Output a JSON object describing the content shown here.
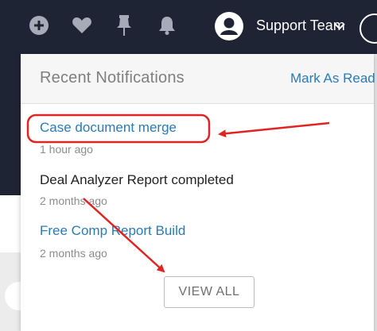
{
  "topbar": {
    "icons": [
      "add-circle-icon",
      "heart-icon",
      "pin-icon",
      "bell-icon"
    ],
    "user_name": "Support Team"
  },
  "dropdown": {
    "title": "Recent Notifications",
    "mark_as_read": "Mark As Read",
    "notifications": [
      {
        "title": "Case document merge",
        "time": "1 hour ago",
        "link": true
      },
      {
        "title": "Deal Analyzer Report completed",
        "time": "2 months ago",
        "link": false
      },
      {
        "title": "Free Comp Report Build",
        "time": "2 months ago",
        "link": true
      }
    ],
    "view_all": "VIEW ALL"
  },
  "colors": {
    "topbar_bg": "#1f2434",
    "link": "#2a7ab6",
    "annotation": "#e02424"
  }
}
